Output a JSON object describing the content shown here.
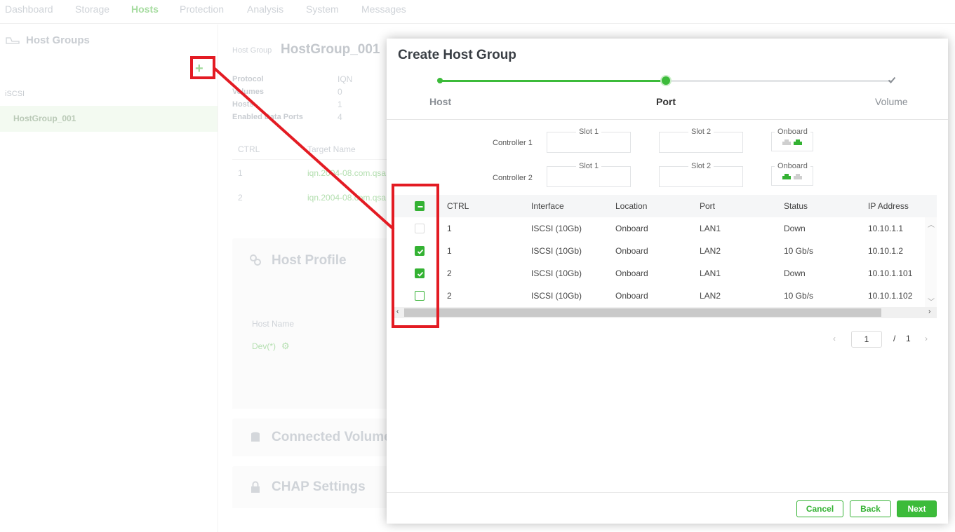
{
  "nav": {
    "items": [
      "Dashboard",
      "Storage",
      "Hosts",
      "Protection",
      "Analysis",
      "System",
      "Messages"
    ],
    "active": "Hosts"
  },
  "sidebar": {
    "title": "Host Groups",
    "add_icon": "+",
    "section": "iSCSI",
    "selected_group": "HostGroup_001"
  },
  "detail": {
    "label": "Host Group",
    "name": "HostGroup_001",
    "fields": [
      {
        "key": "Protocol",
        "value": "IQN"
      },
      {
        "key": "Volumes",
        "value": "0"
      },
      {
        "key": "Hosts",
        "value": "1"
      },
      {
        "key": "Enabled Data Ports",
        "value": "4"
      }
    ],
    "targets": {
      "headers": [
        "CTRL",
        "Target Name"
      ],
      "rows": [
        {
          "ctrl": "1",
          "name": "iqn.2004-08.com.qsa"
        },
        {
          "ctrl": "2",
          "name": "iqn.2004-08.com.qsa"
        }
      ]
    },
    "host_profile": {
      "title": "Host Profile",
      "column": "Host Name",
      "host": "Dev(*)"
    },
    "connected_volumes": "Connected Volumes",
    "chap": "CHAP Settings"
  },
  "modal": {
    "title": "Create Host Group",
    "steps": [
      "Host",
      "Port",
      "Volume"
    ],
    "current_step": 1,
    "controllers": [
      {
        "label": "Controller 1",
        "slot1": "Slot 1",
        "slot2": "Slot 2",
        "onboard": "Onboard",
        "onboard_ports": [
          "inactive",
          "active"
        ]
      },
      {
        "label": "Controller 2",
        "slot1": "Slot 1",
        "slot2": "Slot 2",
        "onboard": "Onboard",
        "onboard_ports": [
          "active",
          "inactive"
        ]
      }
    ],
    "table": {
      "headers": [
        "CTRL",
        "Interface",
        "Location",
        "Port",
        "Status",
        "IP Address"
      ],
      "rows": [
        {
          "checked": false,
          "disabled": true,
          "ctrl": "1",
          "interface": "ISCSI (10Gb)",
          "location": "Onboard",
          "port": "LAN1",
          "status": "Down",
          "ip": "10.10.1.1"
        },
        {
          "checked": true,
          "disabled": false,
          "ctrl": "1",
          "interface": "ISCSI (10Gb)",
          "location": "Onboard",
          "port": "LAN2",
          "status": "10 Gb/s",
          "ip": "10.10.1.2"
        },
        {
          "checked": true,
          "disabled": false,
          "ctrl": "2",
          "interface": "ISCSI (10Gb)",
          "location": "Onboard",
          "port": "LAN1",
          "status": "Down",
          "ip": "10.10.1.101"
        },
        {
          "checked": false,
          "disabled": false,
          "ctrl": "2",
          "interface": "ISCSI (10Gb)",
          "location": "Onboard",
          "port": "LAN2",
          "status": "10 Gb/s",
          "ip": "10.10.1.102"
        }
      ]
    },
    "pagination": {
      "page": "1",
      "separator": "/",
      "total": "1"
    },
    "buttons": {
      "cancel": "Cancel",
      "back": "Back",
      "next": "Next"
    }
  },
  "colors": {
    "accent": "#34b233",
    "annotation": "#e31b23"
  }
}
